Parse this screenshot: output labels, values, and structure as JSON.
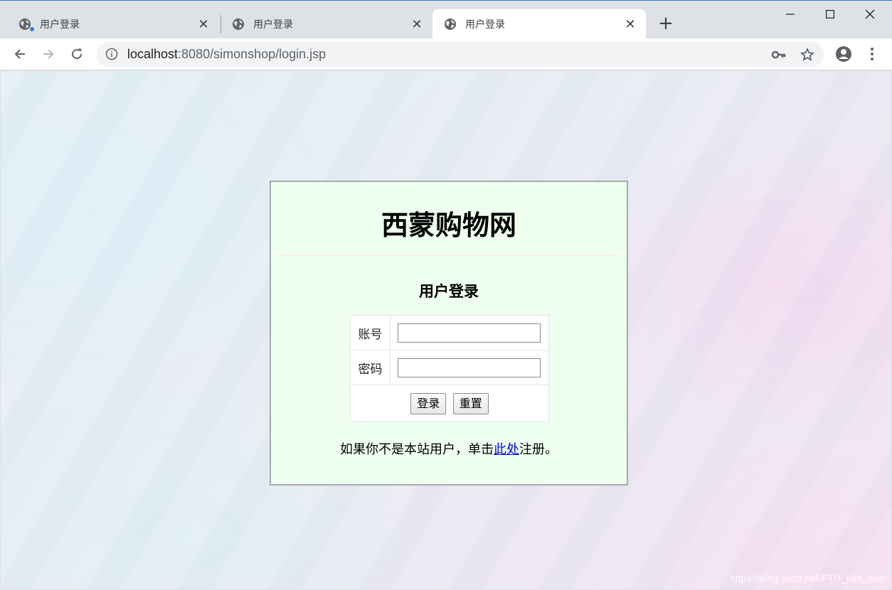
{
  "tabs": [
    {
      "title": "用户登录",
      "active": false,
      "loading": true
    },
    {
      "title": "用户登录",
      "active": false,
      "loading": false
    },
    {
      "title": "用户登录",
      "active": true,
      "loading": false
    }
  ],
  "tab_close_glyph": "✕",
  "new_tab_glyph": "+",
  "window_controls": {
    "minimize": "—",
    "maximize": "☐",
    "close": "✕"
  },
  "address": {
    "host": "localhost",
    "rest": ":8080/simonshop/login.jsp"
  },
  "icons": {
    "back": "back-arrow-icon",
    "forward": "forward-arrow-icon",
    "reload": "reload-icon",
    "site_info": "info-icon",
    "password_key": "key-icon",
    "bookmark": "star-icon",
    "profile": "account-icon",
    "menu": "kebab-menu-icon"
  },
  "colors": {
    "card_background": "#efffef",
    "card_border": "#a9a9a9",
    "link": "#0000ee",
    "tab_indicator": "#3c7bd5"
  },
  "page": {
    "site_title": "西蒙购物网",
    "login_heading": "用户登录",
    "form": {
      "username_label": "账号",
      "username_value": "",
      "password_label": "密码",
      "password_value": "",
      "login_button": "登录",
      "reset_button": "重置"
    },
    "register_prefix": "如果你不是本站用户，单击",
    "register_link": "此处",
    "register_suffix": "注册。"
  },
  "watermark": "https://blog.csdn.net/FTH_lian_hao"
}
